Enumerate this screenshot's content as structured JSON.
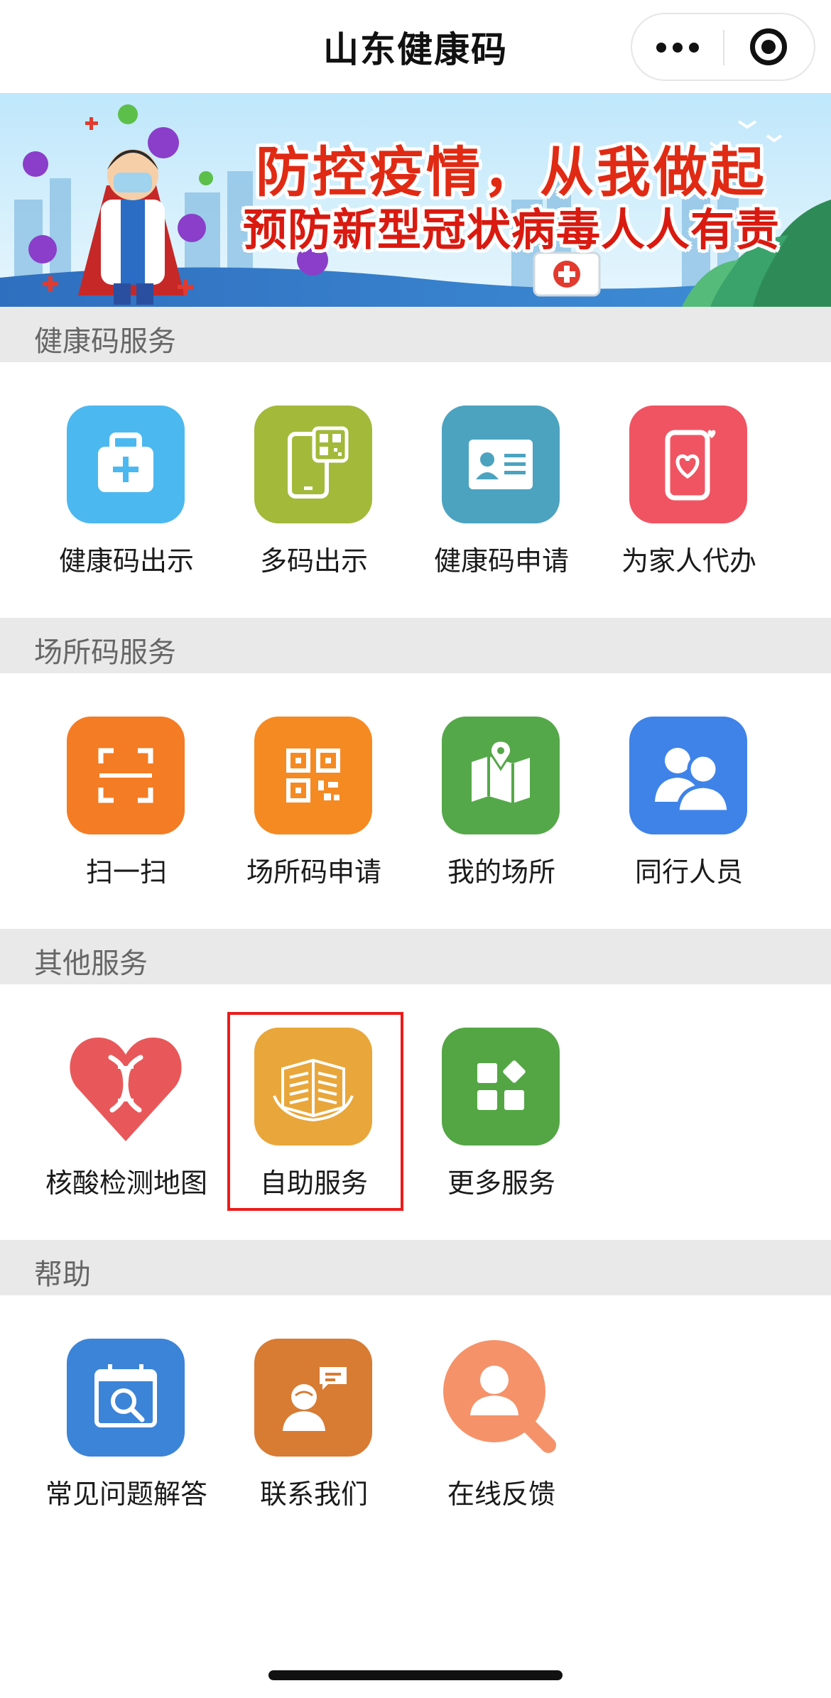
{
  "nav": {
    "title": "山东健康码",
    "more_icon": "more-dots-icon",
    "close_icon": "close-target-icon"
  },
  "banner": {
    "headline": "防控疫情，从我做起",
    "subline": "预防新型冠状病毒人人有责"
  },
  "sections": [
    {
      "title": "健康码服务",
      "items": [
        {
          "label": "健康码出示",
          "icon": "medical-kit-icon",
          "color": "#4cb8f0"
        },
        {
          "label": "多码出示",
          "icon": "phone-qr-icon",
          "color": "#a2b93a"
        },
        {
          "label": "健康码申请",
          "icon": "id-card-icon",
          "color": "#4ba3c0"
        },
        {
          "label": "为家人代办",
          "icon": "phone-heart-icon",
          "color": "#f05463"
        }
      ]
    },
    {
      "title": "场所码服务",
      "items": [
        {
          "label": "扫一扫",
          "icon": "scan-icon",
          "color": "#f47c24"
        },
        {
          "label": "场所码申请",
          "icon": "qr-code-icon",
          "color": "#f58a22"
        },
        {
          "label": "我的场所",
          "icon": "map-pin-icon",
          "color": "#55a849"
        },
        {
          "label": "同行人员",
          "icon": "people-icon",
          "color": "#3f83e8"
        }
      ]
    },
    {
      "title": "其他服务",
      "items": [
        {
          "label": "核酸检测地图",
          "icon": "dna-heart-icon",
          "color": "#e8585a"
        },
        {
          "label": "自助服务",
          "icon": "self-service-book-icon",
          "color": "#e9a63a"
        },
        {
          "label": "更多服务",
          "icon": "more-apps-icon",
          "color": "#54a645"
        }
      ]
    },
    {
      "title": "帮助",
      "items": [
        {
          "label": "常见问题解答",
          "icon": "calendar-search-icon",
          "color": "#3c84d8"
        },
        {
          "label": "联系我们",
          "icon": "contact-agent-icon",
          "color": "#d87b33"
        },
        {
          "label": "在线反馈",
          "icon": "user-search-icon",
          "color": "#f5926a"
        }
      ]
    }
  ],
  "highlight_color": "#ec1c1c"
}
